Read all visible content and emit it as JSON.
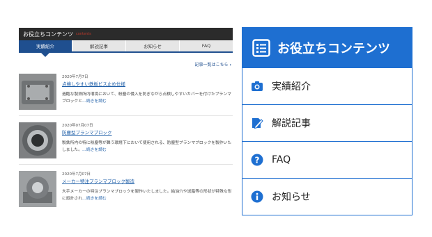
{
  "left_panel": {
    "title": "お役立ちコンテンツ",
    "subtitle": "contents",
    "tabs": [
      "実績紹介",
      "解説記事",
      "お知らせ",
      "FAQ"
    ],
    "active_tab": 0,
    "list_link": "記事一覧はこちら",
    "articles": [
      {
        "date": "2020年7月7日",
        "title": "点検しやすい鉄板ビス止め仕様",
        "text": "過酷な製鉄所内環境において、粉塵の侵入を防ぎながら点検しやすいカバーを付けたプランマブロックと",
        "more": "…続きを読む"
      },
      {
        "date": "2020年07月07日",
        "title": "防塵型プランマブロック",
        "text": "製鉄所内の特に粉塵等が舞う環境下において使用される、防塵型プランマブロックを製作いたしました。",
        "more": "…続きを読む"
      },
      {
        "date": "2020年7月07日",
        "title": "メーカー特注プランマブロック製造",
        "text": "大手メーカーの特注プランマブロックを製作いたしました。給油穴や送脂等の形状が特殊な形に設計され",
        "more": "…続きを読む"
      }
    ]
  },
  "right_panel": {
    "title": "お役立ちコンテンツ",
    "accent_color": "#1e6fd1",
    "items": [
      {
        "label": "実績紹介",
        "icon": "camera-icon"
      },
      {
        "label": "解説記事",
        "icon": "edit-document-icon"
      },
      {
        "label": "FAQ",
        "icon": "question-circle-icon"
      },
      {
        "label": "お知らせ",
        "icon": "info-circle-icon"
      }
    ]
  }
}
